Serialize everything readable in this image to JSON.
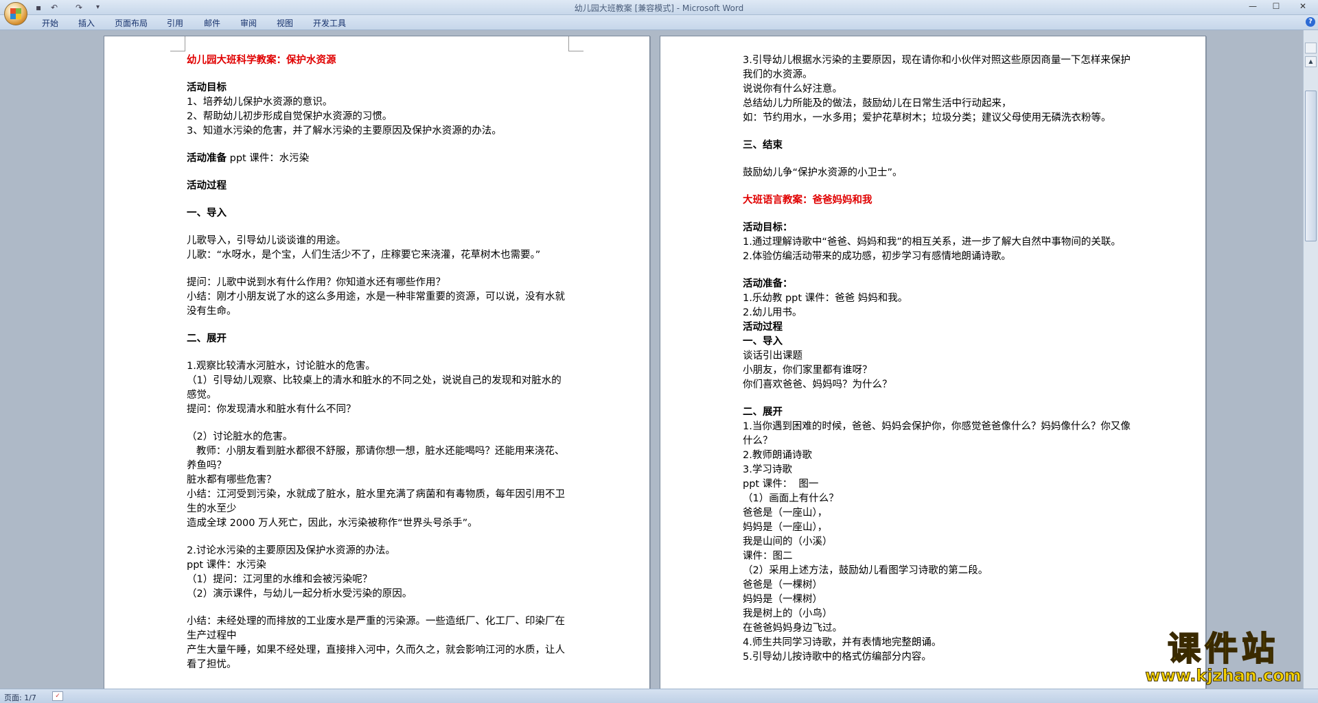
{
  "window": {
    "title": "幼儿园大班教案 [兼容模式] - Microsoft Word",
    "qat_save": "▪",
    "qat_undo": "↶",
    "qat_redo": "↷",
    "qat_more": "▾",
    "min": "—",
    "max": "☐",
    "close": "✕"
  },
  "ribbon": {
    "tabs": [
      "开始",
      "插入",
      "页面布局",
      "引用",
      "邮件",
      "审阅",
      "视图",
      "开发工具"
    ],
    "help": "?"
  },
  "page1": {
    "lines": [
      {
        "t": "幼儿园大班科学教案：保护水资源",
        "s": "red"
      },
      {
        "t": "",
        "s": "gap"
      },
      {
        "t": "活动目标",
        "s": "bold"
      },
      {
        "t": "1、培养幼儿保护水资源的意识。",
        "s": ""
      },
      {
        "t": "2、帮助幼儿初步形成自觉保护水资源的习惯。",
        "s": ""
      },
      {
        "t": "3、知道水污染的危害，并了解水污染的主要原因及保护水资源的办法。",
        "s": ""
      },
      {
        "t": "",
        "s": "gap"
      },
      {
        "t": "活动准备 ppt 课件：水污染",
        "s": "boldprefix"
      },
      {
        "t": "",
        "s": "gap"
      },
      {
        "t": "活动过程",
        "s": "bold"
      },
      {
        "t": "",
        "s": "gap"
      },
      {
        "t": "一、导入",
        "s": "bold"
      },
      {
        "t": "",
        "s": "gap"
      },
      {
        "t": "儿歌导入，引导幼儿谈谈谁的用途。",
        "s": ""
      },
      {
        "t": "儿歌：“水呀水，是个宝，人们生活少不了，庄稼要它来浇灌，花草树木也需要。”",
        "s": ""
      },
      {
        "t": "",
        "s": "gap"
      },
      {
        "t": "提问：儿歌中说到水有什么作用？你知道水还有哪些作用？",
        "s": ""
      },
      {
        "t": "小结：刚才小朋友说了水的这么多用途，水是一种非常重要的资源，可以说，没有水就没有生命。",
        "s": ""
      },
      {
        "t": "",
        "s": "gap"
      },
      {
        "t": "二、展开",
        "s": "bold"
      },
      {
        "t": "",
        "s": "gap"
      },
      {
        "t": "1.观察比较清水河脏水，讨论脏水的危害。",
        "s": ""
      },
      {
        "t": "（1）引导幼儿观察、比较桌上的清水和脏水的不同之处，说说自己的发现和对脏水的感觉。",
        "s": ""
      },
      {
        "t": "提问：你发现清水和脏水有什么不同？",
        "s": ""
      },
      {
        "t": "",
        "s": "gap"
      },
      {
        "t": "（2）讨论脏水的危害。",
        "s": ""
      },
      {
        "t": "   教师：小朋友看到脏水都很不舒服，那请你想一想，脏水还能喝吗？还能用来浇花、养鱼吗？",
        "s": ""
      },
      {
        "t": "脏水都有哪些危害？",
        "s": ""
      },
      {
        "t": "小结：江河受到污染，水就成了脏水，脏水里充满了病菌和有毒物质，每年因引用不卫生的水至少",
        "s": ""
      },
      {
        "t": "造成全球 2000 万人死亡，因此，水污染被称作“世界头号杀手”。",
        "s": ""
      },
      {
        "t": "",
        "s": "gap"
      },
      {
        "t": "2.讨论水污染的主要原因及保护水资源的办法。",
        "s": ""
      },
      {
        "t": "ppt 课件：水污染",
        "s": ""
      },
      {
        "t": "（1）提问：江河里的水维和会被污染呢？",
        "s": ""
      },
      {
        "t": "（2）演示课件，与幼儿一起分析水受污染的原因。",
        "s": ""
      },
      {
        "t": "",
        "s": "gap"
      },
      {
        "t": "小结：未经处理的而排放的工业废水是严重的污染源。一些造纸厂、化工厂、印染厂在生产过程中",
        "s": ""
      },
      {
        "t": "产生大量午睡，如果不经处理，直接排入河中，久而久之，就会影响江河的水质，让人看了担忧。",
        "s": ""
      }
    ]
  },
  "page2": {
    "lines": [
      {
        "t": "3.引导幼儿根据水污染的主要原因，现在请你和小伙伴对照这些原因商量一下怎样来保护我们的水资源。",
        "s": ""
      },
      {
        "t": "说说你有什么好注意。",
        "s": ""
      },
      {
        "t": "总结幼儿力所能及的做法，鼓励幼儿在日常生活中行动起来，",
        "s": ""
      },
      {
        "t": "如：节约用水，一水多用；爱护花草树木；垃圾分类；建议父母使用无磷洗衣粉等。",
        "s": ""
      },
      {
        "t": "",
        "s": "gap"
      },
      {
        "t": "三、结束",
        "s": "bold"
      },
      {
        "t": "",
        "s": "gap"
      },
      {
        "t": "鼓励幼儿争“保护水资源的小卫士”。",
        "s": ""
      },
      {
        "t": "",
        "s": "gap"
      },
      {
        "t": "大班语言教案：爸爸妈妈和我",
        "s": "red"
      },
      {
        "t": "",
        "s": "gap"
      },
      {
        "t": "活动目标：",
        "s": "bold"
      },
      {
        "t": "1.通过理解诗歌中“爸爸、妈妈和我”的相互关系，进一步了解大自然中事物间的关联。",
        "s": ""
      },
      {
        "t": "2.体验仿编活动带来的成功感，初步学习有感情地朗诵诗歌。",
        "s": ""
      },
      {
        "t": "",
        "s": "gap"
      },
      {
        "t": "活动准备：",
        "s": "bold"
      },
      {
        "t": "1.乐幼教 ppt 课件：爸爸 妈妈和我。",
        "s": ""
      },
      {
        "t": "2.幼儿用书。",
        "s": ""
      },
      {
        "t": "活动过程",
        "s": "bold"
      },
      {
        "t": "一、导入",
        "s": "bold"
      },
      {
        "t": "谈话引出课题",
        "s": ""
      },
      {
        "t": "小朋友，你们家里都有谁呀？",
        "s": ""
      },
      {
        "t": "你们喜欢爸爸、妈妈吗？为什么？",
        "s": ""
      },
      {
        "t": "",
        "s": "gap"
      },
      {
        "t": "二、展开",
        "s": "bold"
      },
      {
        "t": "1.当你遇到困难的时候，爸爸、妈妈会保护你，你感觉爸爸像什么？妈妈像什么？你又像什么？",
        "s": ""
      },
      {
        "t": "2.教师朗诵诗歌",
        "s": ""
      },
      {
        "t": "3.学习诗歌",
        "s": ""
      },
      {
        "t": "ppt 课件：  图一",
        "s": ""
      },
      {
        "t": "（1）画面上有什么？",
        "s": ""
      },
      {
        "t": "爸爸是（一座山），",
        "s": ""
      },
      {
        "t": "妈妈是（一座山），",
        "s": ""
      },
      {
        "t": "我是山间的（小溪）",
        "s": ""
      },
      {
        "t": "课件：图二",
        "s": ""
      },
      {
        "t": "（2）采用上述方法，鼓励幼儿看图学习诗歌的第二段。",
        "s": ""
      },
      {
        "t": "爸爸是（一棵树）",
        "s": ""
      },
      {
        "t": "妈妈是（一棵树）",
        "s": ""
      },
      {
        "t": "我是树上的（小鸟）",
        "s": ""
      },
      {
        "t": "在爸爸妈妈身边飞过。",
        "s": ""
      },
      {
        "t": "4.师生共同学习诗歌，并有表情地完整朗诵。",
        "s": ""
      },
      {
        "t": "5.引导幼儿按诗歌中的格式仿编部分内容。",
        "s": ""
      }
    ]
  },
  "status": {
    "page_info": "页面: 1/7",
    "spell_icon": "✓"
  },
  "watermark": {
    "title": "课件站",
    "url": "www.kjzhan.com"
  },
  "colors": {
    "heading_red": "#e00000",
    "ribbon_text": "#15306b",
    "watermark_yellow": "#f5d200"
  }
}
